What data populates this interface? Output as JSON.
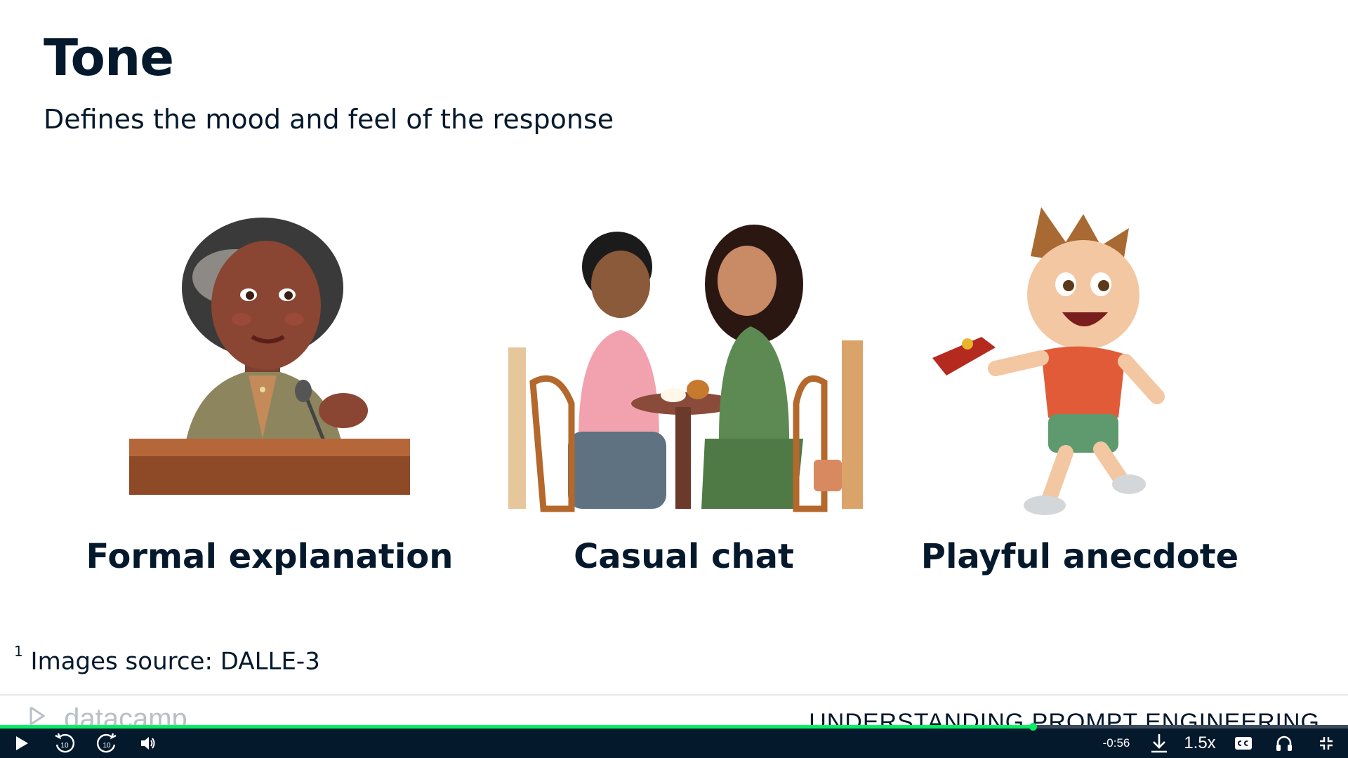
{
  "slide": {
    "title": "Tone",
    "subtitle": "Defines the mood and feel of the response",
    "cards": [
      {
        "label": "Formal explanation",
        "image": "woman-speaking-at-podium"
      },
      {
        "label": "Casual chat",
        "image": "two-women-chatting-at-cafe-table"
      },
      {
        "label": "Playful anecdote",
        "image": "boy-running-with-toy"
      }
    ],
    "footnote": {
      "marker": "1",
      "text": "Images source: DALLE-3"
    }
  },
  "footer": {
    "brand": "datacamp",
    "course_title": "UNDERSTANDING PROMPT ENGINEERING"
  },
  "player": {
    "time_remaining": "-0:56",
    "speed": "1.5x",
    "progress": 0.766,
    "skip_back_seconds": "10",
    "skip_forward_seconds": "10",
    "icons": [
      "play-icon",
      "rewind-10-icon",
      "forward-10-icon",
      "volume-icon",
      "download-icon",
      "captions-icon",
      "headphones-icon",
      "exit-fullscreen-icon"
    ],
    "accent_color": "#03ef62",
    "bar_color": "#05192d"
  }
}
